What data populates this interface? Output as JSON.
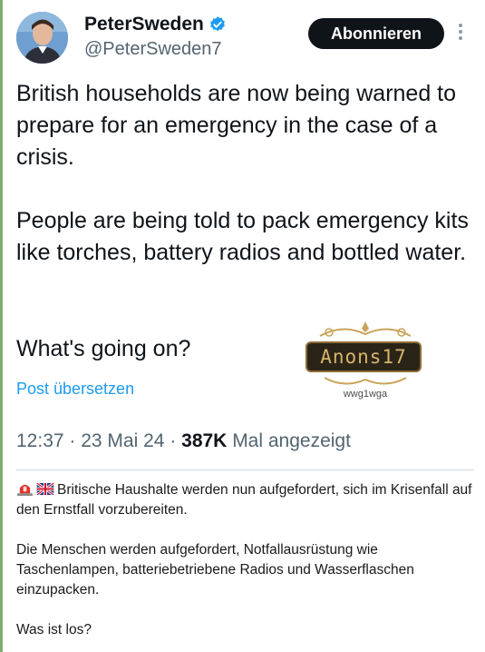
{
  "user": {
    "display_name": "PeterSweden",
    "handle": "@PeterSweden7",
    "verified": true
  },
  "follow_button": {
    "label": "Abonnieren"
  },
  "tweet": {
    "paragraph1": "British households are now being warned to prepare for an emergency in the case of a crisis.",
    "paragraph2": "People are being told to pack emergency kits like torches, battery radios and bottled water.",
    "paragraph3": "What's going on?"
  },
  "translate_link": "Post übersetzen",
  "watermark": {
    "title": "Anons17",
    "subtitle": "wwg1wga"
  },
  "meta": {
    "time": "12:37",
    "date": "23 Mai 24",
    "views": "387K",
    "views_label": "Mal angezeigt"
  },
  "caption": {
    "line1": "Britische Haushalte werden nun aufgefordert, sich im Krisenfall auf den Ernstfall vorzubereiten.",
    "line2": "Die Menschen werden aufgefordert, Notfallausrüstung wie Taschenlampen, batteriebetriebene Radios und Wasserflaschen einzupacken.",
    "line3": "Was ist los?"
  },
  "icons": [
    "siren-icon",
    "uk-flag-icon",
    "verified-badge-icon",
    "more-icon",
    "avatar"
  ]
}
